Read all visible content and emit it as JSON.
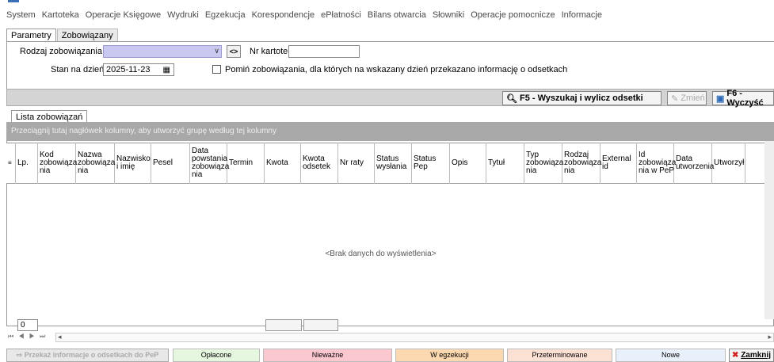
{
  "menu": [
    "System",
    "Kartoteka",
    "Operacje Księgowe",
    "Wydruki",
    "Egzekucja",
    "Korespondencje",
    "ePłatności",
    "Bilans otwarcia",
    "Słowniki",
    "Operacje pomocnicze",
    "Informacje"
  ],
  "tabs": [
    "Parametry",
    "Zobowiązany"
  ],
  "params": {
    "rodzaj_label": "Rodzaj zobowiązania PeP",
    "nr_kartoteki_label": "Nr kartoteki",
    "stan_label": "Stan na dzień",
    "stan_value": "2025-11-23",
    "pomin_label": "Pomiń zobowiązania, dla których na wskazany dzień przekazano informację o odsetkach",
    "swap_label": "<>"
  },
  "toolbar": {
    "f5": "F5 - Wyszukaj i wylicz odsetki",
    "zmien": "Zmień",
    "f6": "F6 - Wyczyść"
  },
  "list_tab": "Lista zobowiązań",
  "grouping": "Przeciągnij tutaj nagłówek kolumny, aby utworzyć grupę według tej kolumny",
  "columns": [
    "Lp.",
    "Kod zobowiąza nia",
    "Nazwa zobowiąza nia",
    "Nazwisko i imię",
    "Pesel",
    "Data powstania zobowiąza nia",
    "Termin",
    "Kwota",
    "Kwota odsetek",
    "Nr raty",
    "Status wysłania",
    "Status Pep",
    "Opis",
    "Tytuł",
    "Typ zobowiąza nia",
    "Rodzaj zobowiąza nia",
    "External id",
    "Id zobowiąza nia w PeP",
    "Data utworzenia",
    "Utworzył"
  ],
  "empty_text": "<Brak danych do wyświetlenia>",
  "count": "0",
  "bottom": {
    "przekaz": "Przekaż informacje o odsetkach do PeP",
    "oplacone": "Opłacone",
    "niewazne": "Nieważne",
    "w_egzekucji": "W egzekucji",
    "przeterminowane": "Przeterminowane",
    "nowe": "Nowe",
    "zamknij": "Zamknij"
  },
  "colors": {
    "oplacone": "#e6f7e0",
    "niewazne": "#fbc8d0",
    "w_egzekucji": "#fbd8b0",
    "przeterminowane": "#fbe0d4",
    "nowe": "#e8f0fb"
  }
}
